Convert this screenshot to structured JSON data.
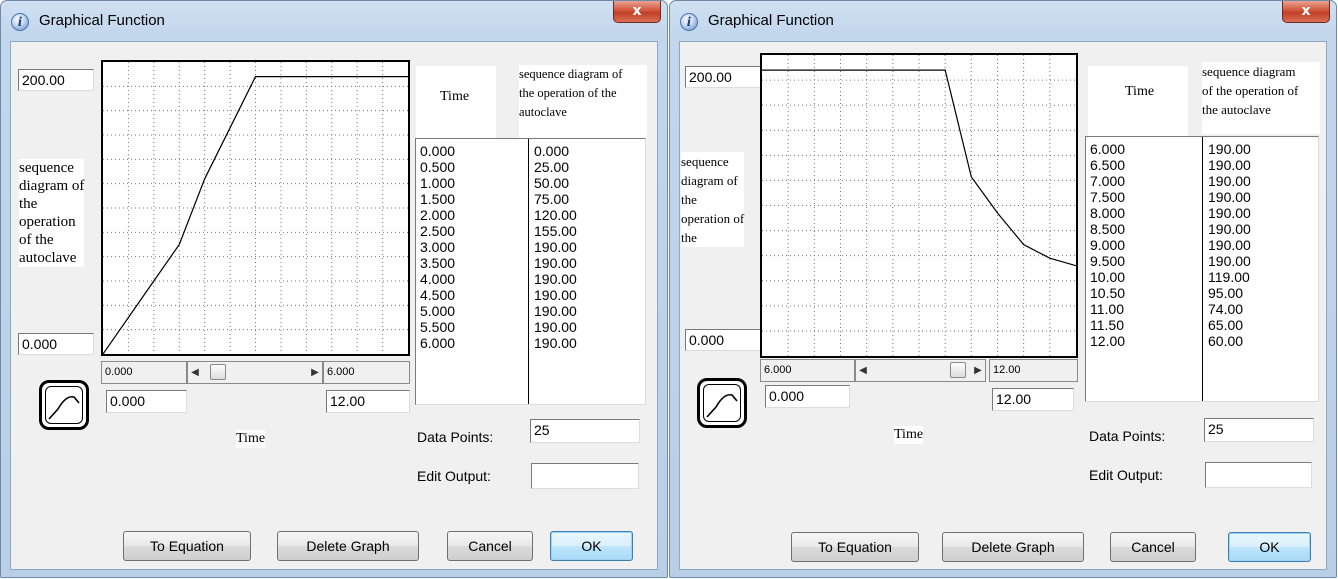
{
  "dialog_left": {
    "title": "Graphical Function",
    "close_glyph": "x",
    "y_max": "200.00",
    "y_min": "0.000",
    "y_label_lines": [
      "sequence",
      "diagram of",
      "the",
      "operation",
      "of the",
      "autoclave"
    ],
    "scroll_left_value": "0.000",
    "scroll_right_value": "6.000",
    "x_min": "0.000",
    "x_max": "12.00",
    "x_label": "Time",
    "table_header_time": "Time",
    "table_header_output_lines": [
      "sequence diagram of",
      "the operation of the",
      "autoclave"
    ],
    "rows": [
      {
        "time": "0.000",
        "value": "0.000"
      },
      {
        "time": "0.500",
        "value": "25.00"
      },
      {
        "time": "1.000",
        "value": "50.00"
      },
      {
        "time": "1.500",
        "value": "75.00"
      },
      {
        "time": "2.000",
        "value": "120.00"
      },
      {
        "time": "2.500",
        "value": "155.00"
      },
      {
        "time": "3.000",
        "value": "190.00"
      },
      {
        "time": "3.500",
        "value": "190.00"
      },
      {
        "time": "4.000",
        "value": "190.00"
      },
      {
        "time": "4.500",
        "value": "190.00"
      },
      {
        "time": "5.000",
        "value": "190.00"
      },
      {
        "time": "5.500",
        "value": "190.00"
      },
      {
        "time": "6.000",
        "value": "190.00"
      }
    ],
    "data_points_label": "Data Points:",
    "data_points_value": "25",
    "edit_output_label": "Edit Output:",
    "edit_output_value": "",
    "buttons": {
      "to_equation": "To Equation",
      "delete_graph": "Delete Graph",
      "cancel": "Cancel",
      "ok": "OK"
    },
    "scroll_position": 0.0
  },
  "dialog_right": {
    "title": "Graphical Function",
    "close_glyph": "x",
    "y_max": "200.00",
    "y_min": "0.000",
    "y_label_lines": [
      "sequence",
      "diagram of",
      "the",
      "operation of",
      "the"
    ],
    "scroll_left_value": "6.000",
    "scroll_right_value": "12.00",
    "x_min": "0.000",
    "x_max": "12.00",
    "x_label": "Time",
    "table_header_time": "Time",
    "table_header_output_lines": [
      "sequence diagram",
      "of the operation of",
      "the autoclave"
    ],
    "rows": [
      {
        "time": "6.000",
        "value": "190.00"
      },
      {
        "time": "6.500",
        "value": "190.00"
      },
      {
        "time": "7.000",
        "value": "190.00"
      },
      {
        "time": "7.500",
        "value": "190.00"
      },
      {
        "time": "8.000",
        "value": "190.00"
      },
      {
        "time": "8.500",
        "value": "190.00"
      },
      {
        "time": "9.000",
        "value": "190.00"
      },
      {
        "time": "9.500",
        "value": "190.00"
      },
      {
        "time": "10.00",
        "value": "119.00"
      },
      {
        "time": "10.50",
        "value": "95.00"
      },
      {
        "time": "11.00",
        "value": "74.00"
      },
      {
        "time": "11.50",
        "value": "65.00"
      },
      {
        "time": "12.00",
        "value": "60.00"
      }
    ],
    "data_points_label": "Data Points:",
    "data_points_value": "25",
    "edit_output_label": "Edit Output:",
    "edit_output_value": "",
    "buttons": {
      "to_equation": "To Equation",
      "delete_graph": "Delete Graph",
      "cancel": "Cancel",
      "ok": "OK"
    },
    "scroll_position": 1.0
  },
  "chart_data": [
    {
      "type": "line",
      "x_range": [
        0,
        6
      ],
      "ylim": [
        0,
        200
      ],
      "grid": true,
      "x": [
        0,
        0.5,
        1,
        1.5,
        2,
        2.5,
        3,
        3.5,
        4,
        4.5,
        5,
        5.5,
        6
      ],
      "series": [
        {
          "values": [
            0,
            25,
            50,
            75,
            120,
            155,
            190,
            190,
            190,
            190,
            190,
            190,
            190
          ]
        }
      ]
    },
    {
      "type": "line",
      "x_range": [
        6,
        12
      ],
      "ylim": [
        0,
        200
      ],
      "grid": true,
      "x": [
        6,
        6.5,
        7,
        7.5,
        8,
        8.5,
        9,
        9.5,
        10,
        10.5,
        11,
        11.5,
        12
      ],
      "series": [
        {
          "values": [
            190,
            190,
            190,
            190,
            190,
            190,
            190,
            190,
            119,
            95,
            74,
            65,
            60
          ]
        }
      ]
    }
  ]
}
